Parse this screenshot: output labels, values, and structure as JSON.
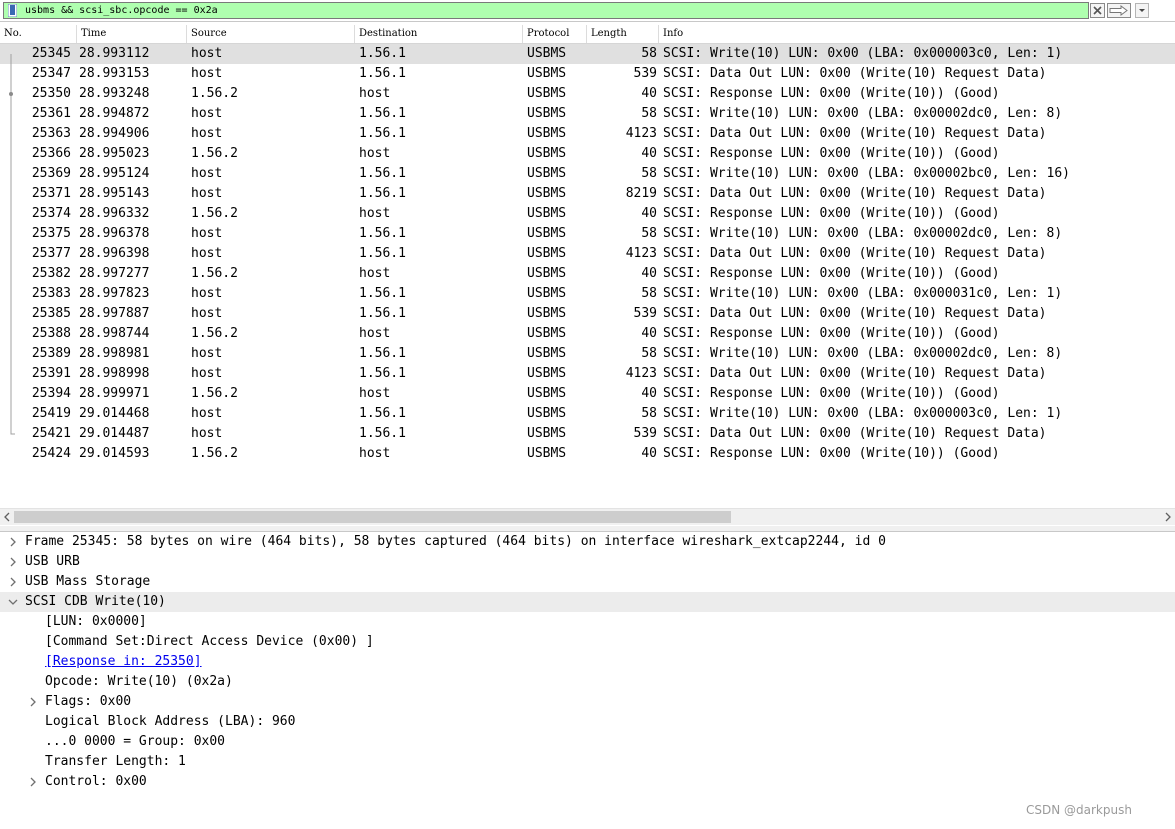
{
  "filter": {
    "text": "usbms && scsi_sbc.opcode == 0x2a",
    "background": "#afffaf"
  },
  "columns": [
    "No.",
    "Time",
    "Source",
    "Destination",
    "Protocol",
    "Length",
    "Info"
  ],
  "packets": [
    {
      "no": "25345",
      "time": "28.993112",
      "src": "host",
      "dst": "1.56.1",
      "proto": "USBMS",
      "len": "58",
      "info": "SCSI: Write(10) LUN: 0x00 (LBA: 0x000003c0, Len: 1)"
    },
    {
      "no": "25347",
      "time": "28.993153",
      "src": "host",
      "dst": "1.56.1",
      "proto": "USBMS",
      "len": "539",
      "info": "SCSI: Data Out LUN: 0x00 (Write(10) Request Data)"
    },
    {
      "no": "25350",
      "time": "28.993248",
      "src": "1.56.2",
      "dst": "host",
      "proto": "USBMS",
      "len": "40",
      "info": "SCSI: Response LUN: 0x00 (Write(10)) (Good)"
    },
    {
      "no": "25361",
      "time": "28.994872",
      "src": "host",
      "dst": "1.56.1",
      "proto": "USBMS",
      "len": "58",
      "info": "SCSI: Write(10) LUN: 0x00 (LBA: 0x00002dc0, Len: 8)"
    },
    {
      "no": "25363",
      "time": "28.994906",
      "src": "host",
      "dst": "1.56.1",
      "proto": "USBMS",
      "len": "4123",
      "info": "SCSI: Data Out LUN: 0x00 (Write(10) Request Data)"
    },
    {
      "no": "25366",
      "time": "28.995023",
      "src": "1.56.2",
      "dst": "host",
      "proto": "USBMS",
      "len": "40",
      "info": "SCSI: Response LUN: 0x00 (Write(10)) (Good)"
    },
    {
      "no": "25369",
      "time": "28.995124",
      "src": "host",
      "dst": "1.56.1",
      "proto": "USBMS",
      "len": "58",
      "info": "SCSI: Write(10) LUN: 0x00 (LBA: 0x00002bc0, Len: 16)"
    },
    {
      "no": "25371",
      "time": "28.995143",
      "src": "host",
      "dst": "1.56.1",
      "proto": "USBMS",
      "len": "8219",
      "info": "SCSI: Data Out LUN: 0x00 (Write(10) Request Data)"
    },
    {
      "no": "25374",
      "time": "28.996332",
      "src": "1.56.2",
      "dst": "host",
      "proto": "USBMS",
      "len": "40",
      "info": "SCSI: Response LUN: 0x00 (Write(10)) (Good)"
    },
    {
      "no": "25375",
      "time": "28.996378",
      "src": "host",
      "dst": "1.56.1",
      "proto": "USBMS",
      "len": "58",
      "info": "SCSI: Write(10) LUN: 0x00 (LBA: 0x00002dc0, Len: 8)"
    },
    {
      "no": "25377",
      "time": "28.996398",
      "src": "host",
      "dst": "1.56.1",
      "proto": "USBMS",
      "len": "4123",
      "info": "SCSI: Data Out LUN: 0x00 (Write(10) Request Data)"
    },
    {
      "no": "25382",
      "time": "28.997277",
      "src": "1.56.2",
      "dst": "host",
      "proto": "USBMS",
      "len": "40",
      "info": "SCSI: Response LUN: 0x00 (Write(10)) (Good)"
    },
    {
      "no": "25383",
      "time": "28.997823",
      "src": "host",
      "dst": "1.56.1",
      "proto": "USBMS",
      "len": "58",
      "info": "SCSI: Write(10) LUN: 0x00 (LBA: 0x000031c0, Len: 1)"
    },
    {
      "no": "25385",
      "time": "28.997887",
      "src": "host",
      "dst": "1.56.1",
      "proto": "USBMS",
      "len": "539",
      "info": "SCSI: Data Out LUN: 0x00 (Write(10) Request Data)"
    },
    {
      "no": "25388",
      "time": "28.998744",
      "src": "1.56.2",
      "dst": "host",
      "proto": "USBMS",
      "len": "40",
      "info": "SCSI: Response LUN: 0x00 (Write(10)) (Good)"
    },
    {
      "no": "25389",
      "time": "28.998981",
      "src": "host",
      "dst": "1.56.1",
      "proto": "USBMS",
      "len": "58",
      "info": "SCSI: Write(10) LUN: 0x00 (LBA: 0x00002dc0, Len: 8)"
    },
    {
      "no": "25391",
      "time": "28.998998",
      "src": "host",
      "dst": "1.56.1",
      "proto": "USBMS",
      "len": "4123",
      "info": "SCSI: Data Out LUN: 0x00 (Write(10) Request Data)"
    },
    {
      "no": "25394",
      "time": "28.999971",
      "src": "1.56.2",
      "dst": "host",
      "proto": "USBMS",
      "len": "40",
      "info": "SCSI: Response LUN: 0x00 (Write(10)) (Good)"
    },
    {
      "no": "25419",
      "time": "29.014468",
      "src": "host",
      "dst": "1.56.1",
      "proto": "USBMS",
      "len": "58",
      "info": "SCSI: Write(10) LUN: 0x00 (LBA: 0x000003c0, Len: 1)"
    },
    {
      "no": "25421",
      "time": "29.014487",
      "src": "host",
      "dst": "1.56.1",
      "proto": "USBMS",
      "len": "539",
      "info": "SCSI: Data Out LUN: 0x00 (Write(10) Request Data)"
    },
    {
      "no": "25424",
      "time": "29.014593",
      "src": "1.56.2",
      "dst": "host",
      "proto": "USBMS",
      "len": "40",
      "info": "SCSI: Response LUN: 0x00 (Write(10)) (Good)"
    }
  ],
  "selected_index": 0,
  "details": [
    {
      "text": "Frame 25345: 58 bytes on wire (464 bits), 58 bytes captured (464 bits) on interface wireshark_extcap2244, id 0",
      "level": 0,
      "arrow": "collapsed"
    },
    {
      "text": "USB URB",
      "level": 0,
      "arrow": "collapsed"
    },
    {
      "text": "USB Mass Storage",
      "level": 0,
      "arrow": "collapsed"
    },
    {
      "text": "SCSI CDB Write(10)",
      "level": 0,
      "arrow": "expanded"
    },
    {
      "text": "[LUN: 0x0000]",
      "level": 1,
      "arrow": "none"
    },
    {
      "text": "[Command Set:Direct Access Device (0x00) ]",
      "level": 1,
      "arrow": "none"
    },
    {
      "text": "[Response in: 25350]",
      "level": 1,
      "arrow": "none",
      "link": true
    },
    {
      "text": "Opcode: Write(10) (0x2a)",
      "level": 1,
      "arrow": "none"
    },
    {
      "text": "Flags: 0x00",
      "level": 1,
      "arrow": "collapsed"
    },
    {
      "text": "Logical Block Address (LBA): 960",
      "level": 1,
      "arrow": "none"
    },
    {
      "text": "...0 0000 = Group: 0x00",
      "level": 1,
      "arrow": "none"
    },
    {
      "text": "Transfer Length: 1",
      "level": 1,
      "arrow": "none"
    },
    {
      "text": "Control: 0x00",
      "level": 1,
      "arrow": "collapsed"
    }
  ],
  "watermark": "CSDN @darkpush",
  "colors": {
    "selected_row": "#e0e0e0",
    "expanded_row": "#ececec",
    "link": "#0000ee"
  }
}
